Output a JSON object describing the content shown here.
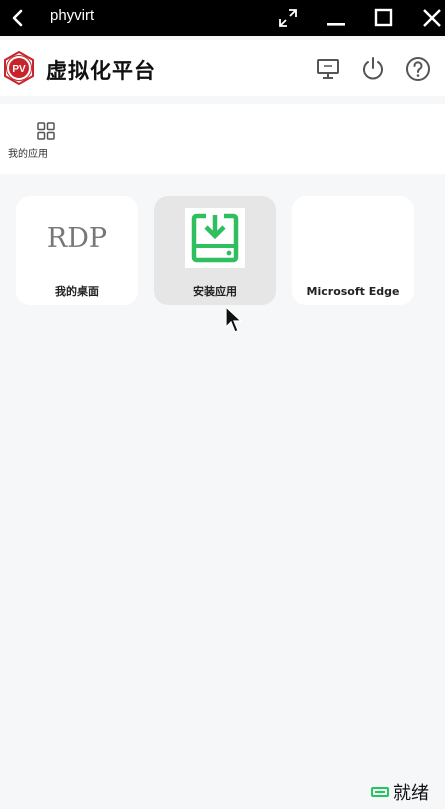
{
  "window": {
    "title": "phyvirt",
    "back_icon": "chevron-left-icon",
    "controls": [
      "expand-icon",
      "minimize-icon",
      "maximize-icon",
      "close-icon"
    ]
  },
  "header": {
    "app_title": "虚拟化平台",
    "logo_text": "PV",
    "actions": [
      "monitor-icon",
      "power-icon",
      "help-icon"
    ]
  },
  "nav": {
    "my_apps_label": "我的应用",
    "my_apps_icon": "grid-icon"
  },
  "apps": [
    {
      "logo_text": "RDP",
      "label": "我的桌面"
    },
    {
      "icon": "install-download-icon",
      "label": "安装应用"
    },
    {
      "label": "Microsoft Edge"
    }
  ],
  "status": {
    "text": "就绪",
    "indicator_color": "#22c55e"
  },
  "colors": {
    "accent": "#c7252b",
    "install_green": "#2fbf5f",
    "titlebar": "#000000"
  }
}
